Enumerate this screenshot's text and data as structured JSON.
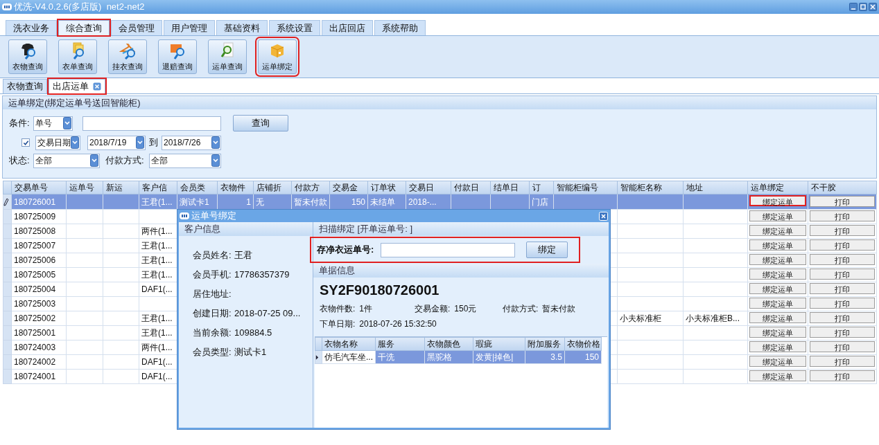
{
  "window": {
    "title": "优洗-V4.0.2.6(多店版)  net2-net2"
  },
  "menu_tabs": [
    {
      "label": "洗衣业务",
      "selected": false,
      "highlighted": false
    },
    {
      "label": "综合查询",
      "selected": true,
      "highlighted": true
    },
    {
      "label": "会员管理",
      "selected": false,
      "highlighted": false
    },
    {
      "label": "用户管理",
      "selected": false,
      "highlighted": false
    },
    {
      "label": "基础资料",
      "selected": false,
      "highlighted": false
    },
    {
      "label": "系统设置",
      "selected": false,
      "highlighted": false
    },
    {
      "label": "出店回店",
      "selected": false,
      "highlighted": false
    },
    {
      "label": "系统帮助",
      "selected": false,
      "highlighted": false
    }
  ],
  "toolbar": [
    {
      "label": "衣物查询",
      "highlighted": false
    },
    {
      "label": "衣单查询",
      "highlighted": false
    },
    {
      "label": "挂衣查询",
      "highlighted": false
    },
    {
      "label": "退赔查询",
      "highlighted": false
    },
    {
      "label": "运单查询",
      "highlighted": false
    },
    {
      "label": "运单绑定",
      "highlighted": true
    }
  ],
  "doc_tabs": [
    {
      "label": "衣物查询",
      "selected": false,
      "highlighted": false,
      "closable": false
    },
    {
      "label": "出店运单",
      "selected": true,
      "highlighted": true,
      "closable": true
    }
  ],
  "panel": {
    "title": "运单绑定(绑定运单号送回智能柜)",
    "condition_label": "条件:",
    "condition_value": "单号",
    "search_button": "查询",
    "date_filter_checked": true,
    "date_field": "交易日期",
    "date_from": "2018/7/19",
    "to_label": "到",
    "date_to": "2018/7/26",
    "status_label": "状态:",
    "status_value": "全部",
    "payment_label": "付款方式:",
    "payment_value": "全部"
  },
  "table": {
    "columns": [
      "交易单号",
      "运单号",
      "新运",
      "客户信",
      "会员类",
      "衣物件",
      "店铺折",
      "付款方",
      "交易金",
      "订单状",
      "交易日",
      "付款日",
      "结单日",
      "订",
      "智能柜编号",
      "智能柜名称",
      "地址",
      "运单绑定",
      "不干胶"
    ],
    "rows": [
      {
        "selected": true,
        "editing": true,
        "order_no": "180726001",
        "customer": "王君(1...",
        "member_type": "测试卡1",
        "item_count": "1",
        "discount": "无",
        "payer": "暂未付款",
        "amount": "150",
        "order_status": "未结单",
        "trade_date": "2018-...",
        "source": "门店",
        "bind_button": "绑定运单",
        "bind_highlighted": true,
        "print_button": "打印"
      },
      {
        "selected": false,
        "editing": false,
        "order_no": "180725009",
        "bind_button": "绑定运单",
        "bind_highlighted": false,
        "print_button": "打印"
      },
      {
        "selected": false,
        "editing": false,
        "order_no": "180725008",
        "customer": "两件(1...",
        "bind_button": "绑定运单",
        "bind_highlighted": false,
        "print_button": "打印"
      },
      {
        "selected": false,
        "editing": false,
        "order_no": "180725007",
        "customer": "王君(1...",
        "bind_button": "绑定运单",
        "bind_highlighted": false,
        "print_button": "打印"
      },
      {
        "selected": false,
        "editing": false,
        "order_no": "180725006",
        "customer": "王君(1...",
        "bind_button": "绑定运单",
        "bind_highlighted": false,
        "print_button": "打印"
      },
      {
        "selected": false,
        "editing": false,
        "order_no": "180725005",
        "customer": "王君(1...",
        "bind_button": "绑定运单",
        "bind_highlighted": false,
        "print_button": "打印"
      },
      {
        "selected": false,
        "editing": false,
        "order_no": "180725004",
        "customer": "DAF1(...",
        "bind_button": "绑定运单",
        "bind_highlighted": false,
        "print_button": "打印"
      },
      {
        "selected": false,
        "editing": false,
        "order_no": "180725003",
        "bind_button": "绑定运单",
        "bind_highlighted": false,
        "print_button": "打印"
      },
      {
        "selected": false,
        "editing": false,
        "order_no": "180725002",
        "customer": "王君(1...",
        "cabinet_name": "小夫标准柜",
        "address": "小夫标准柜B...",
        "bind_button": "绑定运单",
        "bind_highlighted": false,
        "print_button": "打印"
      },
      {
        "selected": false,
        "editing": false,
        "order_no": "180725001",
        "customer": "王君(1...",
        "bind_button": "绑定运单",
        "bind_highlighted": false,
        "print_button": "打印"
      },
      {
        "selected": false,
        "editing": false,
        "order_no": "180724003",
        "customer": "两件(1...",
        "bind_button": "绑定运单",
        "bind_highlighted": false,
        "print_button": "打印"
      },
      {
        "selected": false,
        "editing": false,
        "order_no": "180724002",
        "customer": "DAF1(...",
        "bind_button": "绑定运单",
        "bind_highlighted": false,
        "print_button": "打印"
      },
      {
        "selected": false,
        "editing": false,
        "order_no": "180724001",
        "customer": "DAF1(...",
        "bind_button": "绑定运单",
        "bind_highlighted": false,
        "print_button": "打印"
      }
    ]
  },
  "dialog": {
    "title": "运单号绑定",
    "customer_header": "客户信息",
    "customer_fields": [
      {
        "label": "会员姓名:",
        "value": "王君"
      },
      {
        "label": "会员手机:",
        "value": "17786357379"
      },
      {
        "label": "居住地址:"
      },
      {
        "label": "创建日期:",
        "value": "2018-07-25 09..."
      },
      {
        "label": "当前余额:",
        "value": "109884.5"
      },
      {
        "label": "会员类型:",
        "value": "测试卡1"
      }
    ],
    "scan_header": "扫描绑定 [开单运单号: ]",
    "scan_label": "存净衣运单号:",
    "scan_highlighted": true,
    "bind_button": "绑定",
    "doc_header": "单据信息",
    "order_code": "SY2F90180726001",
    "info": [
      {
        "label": "衣物件数:",
        "value": "1件"
      },
      {
        "label": "交易金额:",
        "value": "150元"
      },
      {
        "label": "付款方式:",
        "value": "暂未付款"
      }
    ],
    "order_date": {
      "label": "下单日期:",
      "value": "2018-07-26 15:32:50"
    },
    "items": {
      "columns": [
        "衣物名称",
        "服务",
        "衣物颜色",
        "瑕疵",
        "附加服务",
        "衣物价格"
      ],
      "rows": [
        {
          "selected": true,
          "cells": [
            "仿毛汽车坐...",
            "干洗",
            "黑驼格",
            "发黄|掉色|",
            "3.5",
            "150"
          ]
        }
      ]
    }
  }
}
